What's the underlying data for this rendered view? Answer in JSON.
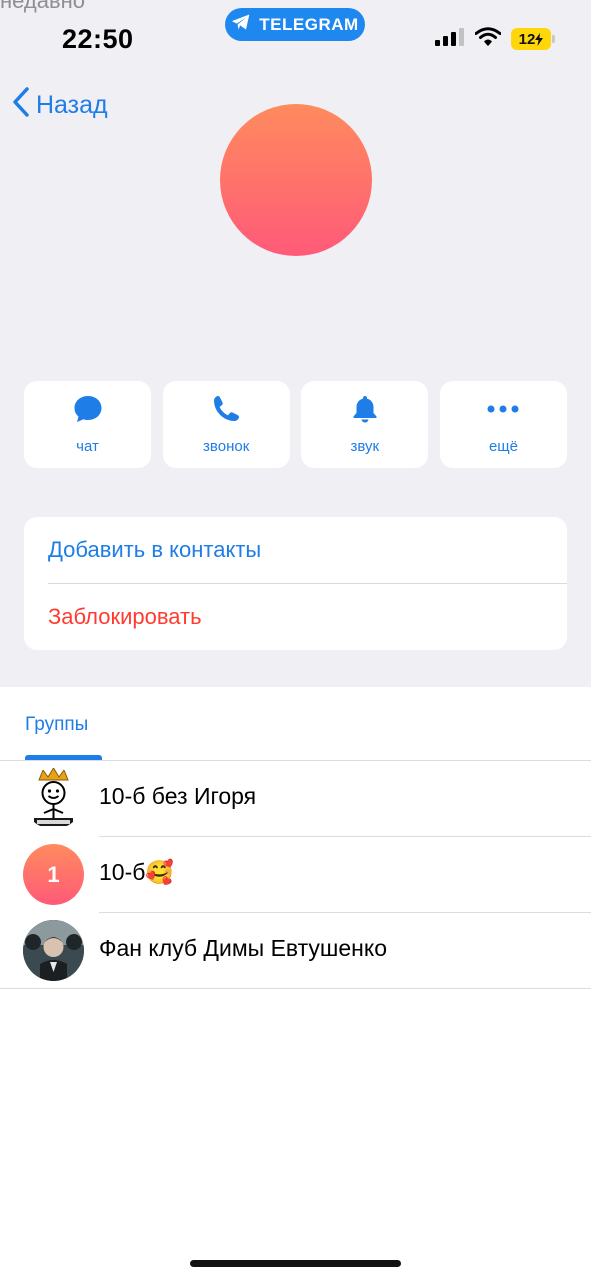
{
  "status_bar": {
    "last_seen": "недавно",
    "time": "22:50",
    "app_pill": "TELEGRAM",
    "battery": "12"
  },
  "nav": {
    "back_label": "Назад"
  },
  "profile": {
    "avatar_color": "#ff6f6b"
  },
  "actions": [
    {
      "label": "чат",
      "icon": "chat-bubble-icon"
    },
    {
      "label": "звонок",
      "icon": "phone-icon"
    },
    {
      "label": "звук",
      "icon": "bell-icon"
    },
    {
      "label": "ещё",
      "icon": "more-icon"
    }
  ],
  "contact_actions": {
    "add_contact": "Добавить в контакты",
    "block": "Заблокировать"
  },
  "tabs": {
    "groups_label": "Группы"
  },
  "groups": [
    {
      "name": "10-б без Игоря",
      "avatar": "sketch-crown-avatar"
    },
    {
      "name": "10-б🥰",
      "avatar_initial": "1"
    },
    {
      "name": "Фан клуб Димы Евтушенко",
      "avatar": "photo-avatar"
    }
  ],
  "colors": {
    "accent": "#1e7de6",
    "destructive": "#ff3b30",
    "background": "#efeff4",
    "telegram_pill": "#1e88f0"
  }
}
